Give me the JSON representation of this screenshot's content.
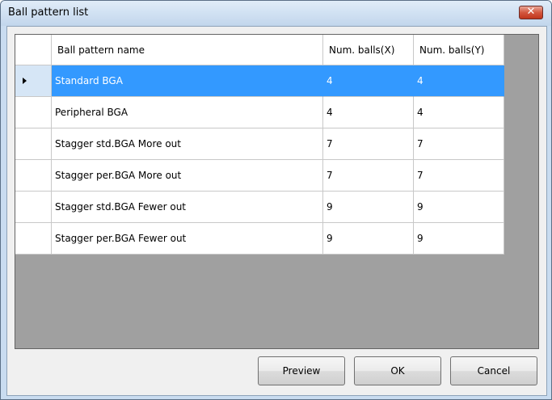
{
  "window": {
    "title": "Ball pattern list",
    "close_glyph": "✕"
  },
  "table": {
    "columns": [
      "Ball pattern name",
      "Num. balls(X)",
      "Num. balls(Y)"
    ],
    "rows": [
      {
        "name": "Standard BGA",
        "x": "4",
        "y": "4",
        "selected": true
      },
      {
        "name": "Peripheral BGA",
        "x": "4",
        "y": "4",
        "selected": false
      },
      {
        "name": "Stagger std.BGA More out",
        "x": "7",
        "y": "7",
        "selected": false
      },
      {
        "name": "Stagger per.BGA More out",
        "x": "7",
        "y": "7",
        "selected": false
      },
      {
        "name": "Stagger std.BGA Fewer out",
        "x": "9",
        "y": "9",
        "selected": false
      },
      {
        "name": "Stagger per.BGA Fewer out",
        "x": "9",
        "y": "9",
        "selected": false
      }
    ]
  },
  "buttons": {
    "preview": "Preview",
    "ok": "OK",
    "cancel": "Cancel"
  },
  "colors": {
    "selection": "#3399ff",
    "grid_background": "#a0a0a0"
  }
}
